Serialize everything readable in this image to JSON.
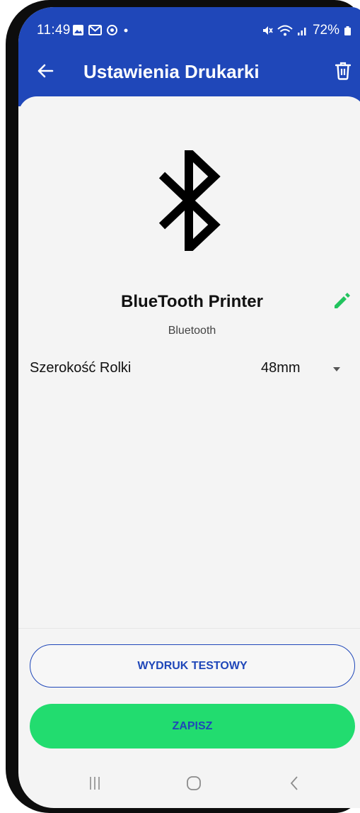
{
  "status_bar": {
    "time": "11:49",
    "left_icons": [
      "image-icon",
      "gmail-icon",
      "sync-icon",
      "dot-icon"
    ],
    "right_icons": [
      "mute-icon",
      "wifi-icon",
      "signal-icon"
    ],
    "battery": "72%"
  },
  "app_bar": {
    "title": "Ustawienia Drukarki",
    "back_icon": "arrow-left-icon",
    "delete_icon": "trash-icon"
  },
  "printer": {
    "icon": "bluetooth-icon",
    "name": "BlueTooth Printer",
    "type": "Bluetooth",
    "edit_icon": "pencil-icon"
  },
  "settings": {
    "roll_width_label": "Szerokość Rolki",
    "roll_width_value": "48mm"
  },
  "buttons": {
    "test_print": "WYDRUK TESTOWY",
    "save": "ZAPISZ"
  },
  "colors": {
    "primary": "#1f47b9",
    "accent": "#22dc6f",
    "background": "#f4f4f4"
  },
  "nav": [
    "recents-icon",
    "home-icon",
    "back-icon"
  ]
}
